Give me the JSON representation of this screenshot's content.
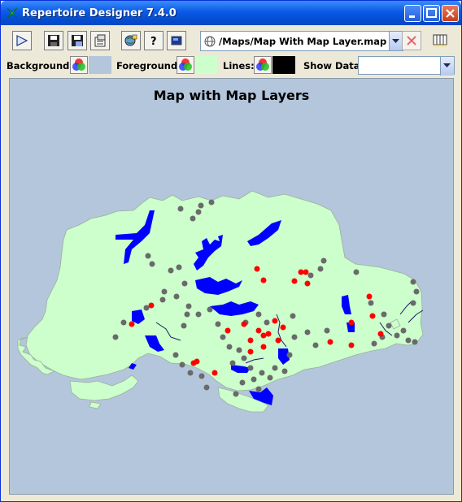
{
  "window": {
    "title": "Repertoire Designer 7.4.0",
    "accent": "#0a5ae8"
  },
  "toolbar": {
    "map_path": "/Maps/Map With Map Layer.map",
    "icons": [
      "play-icon",
      "save-icon",
      "save-as-icon",
      "properties-icon",
      "globe-settings-icon",
      "help-icon",
      "preview-icon",
      "delete-icon",
      "columns-icon"
    ]
  },
  "controls": {
    "background_label": "Background:",
    "foreground_label": "Foreground:",
    "lines_label": "Lines:",
    "show_data_label": "Show Data:",
    "show_data_value": "",
    "background_color": "#b4c6dc",
    "foreground_color": "#ccffcc",
    "lines_color": "#000000"
  },
  "map": {
    "title": "Map with Map Layers",
    "land_color": "#ccffcc",
    "water_color": "#0000ff",
    "gray_point_color": "#6a6a6a",
    "red_point_color": "#ff0000"
  }
}
